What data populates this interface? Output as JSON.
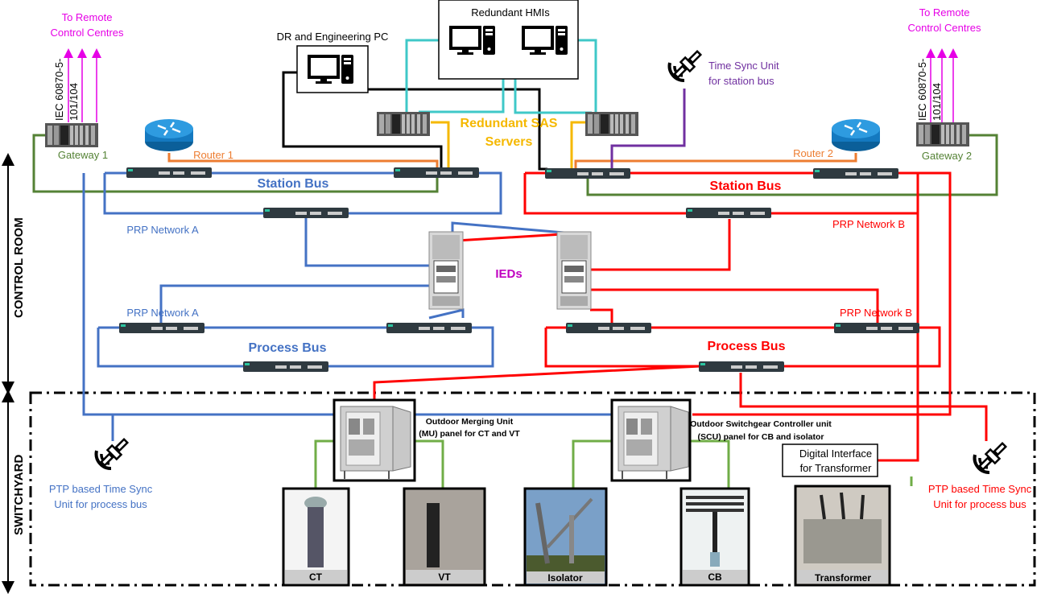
{
  "zones": {
    "control_room": "CONTROL ROOM",
    "switchyard": "SWITCHYARD"
  },
  "remote": {
    "left": {
      "line1": "To Remote",
      "line2": "Control Centres",
      "protocol1": "IEC 60870-5-",
      "protocol2": "101/104",
      "gateway": "Gateway 1",
      "router": "Router 1"
    },
    "right": {
      "line1": "To Remote",
      "line2": "Control Centres",
      "protocol1": "IEC 60870-5-",
      "protocol2": "101/104",
      "gateway": "Gateway 2",
      "router": "Router 2"
    }
  },
  "hmi": {
    "title": "Redundant HMIs"
  },
  "dr_pc": {
    "title": "DR and Engineering PC"
  },
  "sas": {
    "line1": "Redundant SAS",
    "line2": "Servers"
  },
  "time_sync_station": {
    "line1": "Time Sync Unit",
    "line2": "for station bus"
  },
  "networks": {
    "station_bus_a": "Station Bus",
    "station_bus_b": "Station Bus",
    "prp_a_station": "PRP Network A",
    "prp_b_station": "PRP Network B",
    "prp_a_process": "PRP Network A",
    "prp_b_process": "PRP Network B",
    "process_bus_a": "Process Bus",
    "process_bus_b": "Process Bus",
    "ieds": "IEDs"
  },
  "switchyard": {
    "mu_panel": {
      "line1": "Outdoor Merging Unit",
      "line2": "(MU) panel for CT and VT"
    },
    "scu_panel": {
      "line1": "Outdoor Switchgear Controller unit",
      "line2": "(SCU) panel for CB and isolator"
    },
    "digital_interface": {
      "line1": "Digital Interface",
      "line2": "for Transformer"
    },
    "ptp_left": {
      "line1": "PTP based Time Sync",
      "line2": "Unit for process bus"
    },
    "ptp_right": {
      "line1": "PTP based Time Sync",
      "line2": "Unit for process bus"
    },
    "equipment": [
      "CT",
      "VT",
      "Isolator",
      "CB",
      "Transformer"
    ]
  },
  "colors": {
    "prp_a": "#4472c4",
    "prp_b": "#ff0000",
    "gateway_link": "#548235",
    "router_link": "#ed7d31",
    "hmi_link": "#3fc8c8",
    "sas_link": "#f5b800",
    "time_sync_link": "#7030a0",
    "remote_arrows": "#e600e6",
    "equipment_link": "#70ad47"
  }
}
